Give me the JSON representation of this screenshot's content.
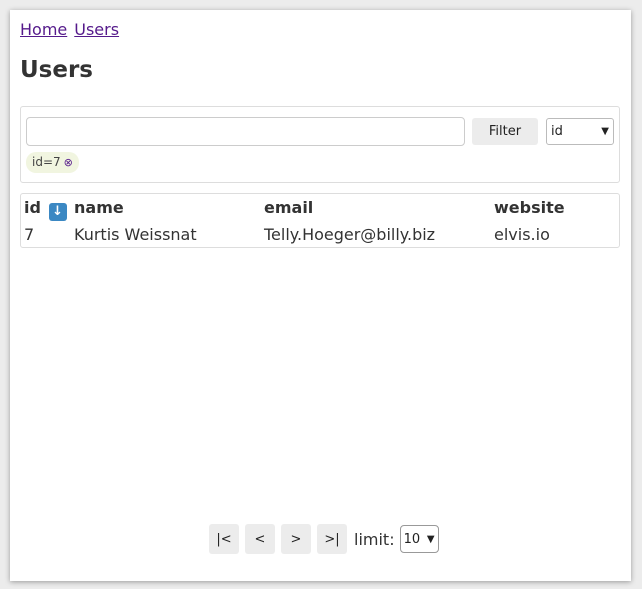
{
  "breadcrumb": {
    "items": [
      "Home",
      "Users"
    ]
  },
  "page": {
    "title": "Users"
  },
  "filter": {
    "input_value": "",
    "button_label": "Filter",
    "field_select_value": "id",
    "active_tag": "id=7",
    "tag_remove_glyph": "⊗"
  },
  "table": {
    "columns": [
      "id",
      "name",
      "email",
      "website"
    ],
    "sort_icon": "↓",
    "rows": [
      [
        "7",
        "Kurtis Weissnat",
        "Telly.Hoeger@billy.biz",
        "elvis.io"
      ]
    ]
  },
  "pagination": {
    "first": "|<",
    "prev": "<",
    "next": ">",
    "last": ">|",
    "limit_label": "limit:",
    "limit_value": "10"
  },
  "colors": {
    "link": "#551a8b",
    "sort_icon_bg": "#3b88c3",
    "tag_bg": "#f1f5e0",
    "button_bg": "#ececec"
  }
}
